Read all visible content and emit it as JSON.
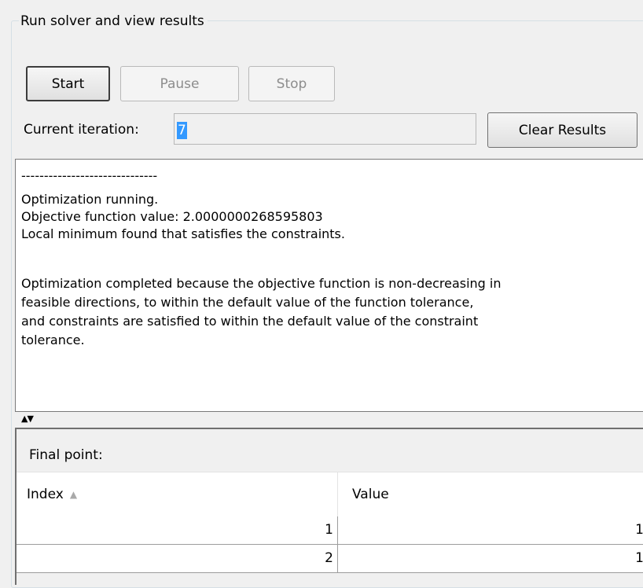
{
  "group": {
    "title": "Run solver and view results"
  },
  "controls": {
    "start_label": "Start",
    "pause_label": "Pause",
    "stop_label": "Stop",
    "clear_label": "Clear Results"
  },
  "iteration": {
    "label": "Current iteration:",
    "value": "7"
  },
  "log": {
    "lines": [
      "------------------------------",
      "Optimization running.",
      "Objective function value: 2.0000000268595803",
      "Local minimum found that satisfies the constraints.",
      "",
      "Optimization completed because the objective function is non-decreasing in",
      "feasible directions, to within the default value of the function tolerance,",
      "and constraints are satisfied to within the default value of the constraint",
      "tolerance."
    ]
  },
  "splitter": {
    "icon": "expand-collapse-arrows"
  },
  "final_point": {
    "label": "Final point:",
    "columns": [
      "Index",
      "Value"
    ],
    "sort_icon": "sort-ascending",
    "rows": [
      {
        "index": "1",
        "value": "1"
      },
      {
        "index": "2",
        "value": "1"
      }
    ]
  }
}
